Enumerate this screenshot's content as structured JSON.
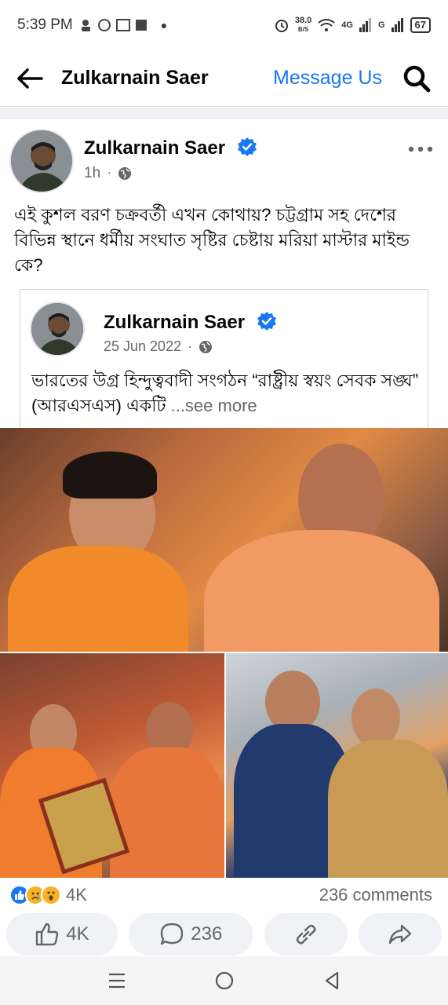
{
  "status_bar": {
    "time": "5:39 PM",
    "speed_value": "38.0",
    "speed_unit": "B/S",
    "network_1": "4G",
    "network_2": "G",
    "battery": "67"
  },
  "header": {
    "title": "Zulkarnain Saer",
    "message_link": "Message Us"
  },
  "post": {
    "author": "Zulkarnain Saer",
    "time": "1h",
    "text": "এই কুশল বরণ চক্রবর্তী এখন কোথায়? চট্টগ্রাম সহ দেশের বিভিন্ন স্থানে ধর্মীয় সংঘাত সৃষ্টির চেষ্টায় মরিয়া মাস্টার মাইন্ড কে?",
    "shared": {
      "author": "Zulkarnain Saer",
      "date": "25 Jun 2022",
      "text": "ভারতের উগ্র হিন্দুত্ববাদী সংগঠন “রাষ্ট্রীয় স্বয়ং সেবক সঙ্ঘ” (আরএসএস) একটি ",
      "see_more": "...see more"
    },
    "reaction_count": "4K",
    "comments_count": "236 comments",
    "actions": {
      "like_count": "4K",
      "comment_count": "236"
    }
  },
  "colors": {
    "brand_blue": "#1877f2",
    "secondary_text": "#65676b",
    "pill_background": "#f0f2f5"
  },
  "icons": [
    "back-arrow-icon",
    "search-icon",
    "verified-badge-icon",
    "globe-icon",
    "more-options-icon",
    "like-reaction-icon",
    "sad-reaction-icon",
    "wow-reaction-icon",
    "like-icon",
    "comment-icon",
    "link-icon",
    "share-icon",
    "menu-icon",
    "home-icon",
    "back-nav-icon"
  ]
}
